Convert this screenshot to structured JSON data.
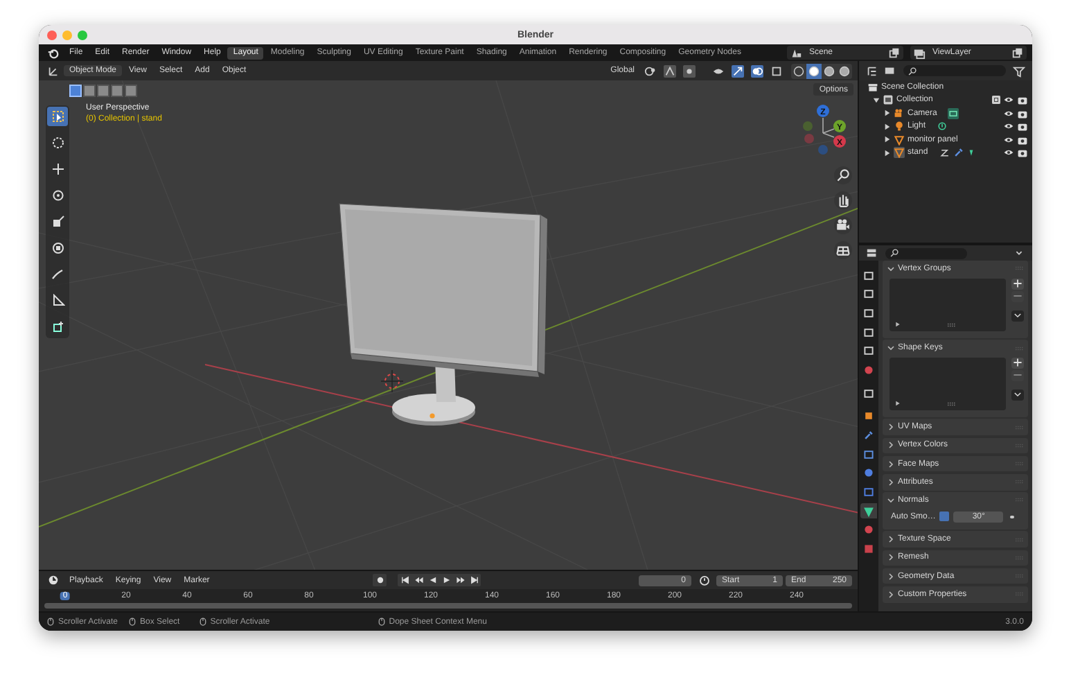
{
  "window": {
    "title": "Blender"
  },
  "menu": [
    "File",
    "Edit",
    "Render",
    "Window",
    "Help"
  ],
  "workspaces": [
    {
      "label": "Layout",
      "selected": true
    },
    {
      "label": "Modeling",
      "selected": false
    },
    {
      "label": "Sculpting",
      "selected": false
    },
    {
      "label": "UV Editing",
      "selected": false
    },
    {
      "label": "Texture Paint",
      "selected": false
    },
    {
      "label": "Shading",
      "selected": false
    },
    {
      "label": "Animation",
      "selected": false
    },
    {
      "label": "Rendering",
      "selected": false
    },
    {
      "label": "Compositing",
      "selected": false
    },
    {
      "label": "Geometry Nodes",
      "selected": false
    }
  ],
  "scene": {
    "label": "Scene"
  },
  "view_layer": {
    "label": "ViewLayer"
  },
  "viewport": {
    "mode": "Object Mode",
    "menus": [
      "View",
      "Select",
      "Add",
      "Object"
    ],
    "orientation": "Global",
    "options": "Options",
    "perspective": "User Perspective",
    "context": "(0) Collection | stand",
    "shading": [
      {
        "selected": false
      },
      {
        "selected": true
      },
      {
        "selected": false
      },
      {
        "selected": false
      }
    ],
    "select_modes": [
      {
        "selected": true
      },
      {
        "selected": false
      },
      {
        "selected": false
      },
      {
        "selected": false
      },
      {
        "selected": false
      }
    ],
    "tools": [
      {
        "kind": "select",
        "selected": true
      },
      {
        "kind": "cursor",
        "selected": false
      },
      {
        "kind": "move",
        "selected": false
      },
      {
        "kind": "rotate",
        "selected": false
      },
      {
        "kind": "scale",
        "selected": false
      },
      {
        "kind": "transform",
        "selected": false
      },
      {
        "kind": "annotate",
        "selected": false
      },
      {
        "kind": "measure",
        "selected": false
      },
      {
        "kind": "add-cube",
        "selected": false
      }
    ],
    "axes": [
      {
        "label": "Z",
        "color": "#2e6fd8"
      },
      {
        "label": "Y",
        "color": "#6da32a"
      },
      {
        "label": "X",
        "color": "#d4394b"
      }
    ]
  },
  "outliner": {
    "root": "Scene Collection",
    "collections": [
      {
        "label": "Collection",
        "expanded": true,
        "checked": true,
        "children": [
          {
            "label": "Camera",
            "kind": "camera",
            "expanded": false
          },
          {
            "label": "Light",
            "kind": "light",
            "expanded": false
          },
          {
            "label": "monitor panel",
            "kind": "mesh",
            "expanded": false
          },
          {
            "label": "stand",
            "kind": "mesh-modified",
            "expanded": false
          }
        ]
      }
    ]
  },
  "properties": {
    "tabs": [
      {
        "color": "#cfcfcf",
        "selected": false
      },
      {
        "color": "#cfcfcf",
        "selected": false
      },
      {
        "color": "#cfcfcf",
        "selected": false
      },
      {
        "color": "#cfcfcf",
        "selected": false
      },
      {
        "color": "#cfcfcf",
        "selected": false
      },
      {
        "color": "#d2444f",
        "selected": false
      },
      {
        "color": "#cfcfcf",
        "selected": false
      },
      {
        "color": "#e8892a",
        "selected": false
      },
      {
        "color": "#5d8fe0",
        "selected": false
      },
      {
        "color": "#5d8fe0",
        "selected": false
      },
      {
        "color": "#4f7ee0",
        "selected": false
      },
      {
        "color": "#4f7ee0",
        "selected": false
      },
      {
        "color": "#3fcf9a",
        "selected": true
      },
      {
        "color": "#d2444f",
        "selected": false
      },
      {
        "color": "#c9414b",
        "selected": false
      }
    ],
    "panels": [
      {
        "label": "Vertex Groups",
        "expanded": true,
        "kind": "list"
      },
      {
        "label": "Shape Keys",
        "expanded": true,
        "kind": "list"
      },
      {
        "label": "UV Maps",
        "expanded": false
      },
      {
        "label": "Vertex Colors",
        "expanded": false
      },
      {
        "label": "Face Maps",
        "expanded": false
      },
      {
        "label": "Attributes",
        "expanded": false
      },
      {
        "label": "Normals",
        "expanded": true,
        "kind": "normals",
        "field_label": "Auto Smo…",
        "checked": true,
        "value": "30°"
      },
      {
        "label": "Texture Space",
        "expanded": false
      },
      {
        "label": "Remesh",
        "expanded": false
      },
      {
        "label": "Geometry Data",
        "expanded": false
      },
      {
        "label": "Custom Properties",
        "expanded": false
      }
    ]
  },
  "timeline": {
    "menus": [
      "Playback",
      "Keying",
      "View",
      "Marker"
    ],
    "frame": "0",
    "start_label": "Start",
    "start": "1",
    "end_label": "End",
    "end": "250",
    "ticks": [
      {
        "label": "0",
        "selected": true
      },
      {
        "label": "20",
        "selected": false
      },
      {
        "label": "40",
        "selected": false
      },
      {
        "label": "60",
        "selected": false
      },
      {
        "label": "80",
        "selected": false
      },
      {
        "label": "100",
        "selected": false
      },
      {
        "label": "120",
        "selected": false
      },
      {
        "label": "140",
        "selected": false
      },
      {
        "label": "160",
        "selected": false
      },
      {
        "label": "180",
        "selected": false
      },
      {
        "label": "200",
        "selected": false
      },
      {
        "label": "220",
        "selected": false
      },
      {
        "label": "240",
        "selected": false
      }
    ]
  },
  "status_bar": {
    "hints": [
      "Scroller Activate",
      "Box Select",
      "Scroller Activate",
      "Dope Sheet Context Menu"
    ],
    "version": "3.0.0"
  }
}
